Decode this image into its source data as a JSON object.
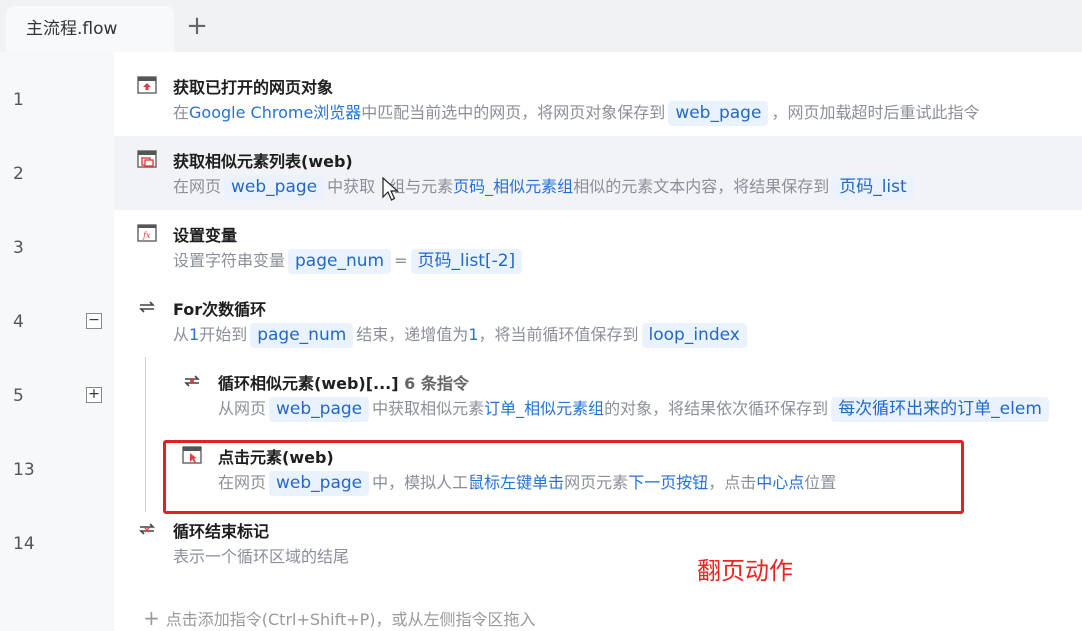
{
  "tab": {
    "label": "主流程.flow",
    "add_symbol": "+"
  },
  "line_numbers": [
    "1",
    "2",
    "3",
    "4",
    "5",
    "13",
    "14"
  ],
  "fold": {
    "collapse": "−",
    "expand": "+"
  },
  "steps": [
    {
      "title": "获取已打开的网页对象",
      "desc": {
        "prefix": "在",
        "browser": "Google Chrome浏览器",
        "mid": "中匹配当前选中的网页，将网页对象保存到",
        "var": "web_page",
        "suffix": "，网页加载超时后重试此指令"
      }
    },
    {
      "title": "获取相似元素列表(web)",
      "desc": {
        "prefix": "在网页",
        "var": "web_page",
        "mid1": "中获取",
        "mid1b": "组与元素",
        "element": "页码_相似元素组",
        "mid2": "相似的元素文本内容，将结果保存到",
        "result": "页码_list"
      }
    },
    {
      "title": "设置变量",
      "desc": {
        "prefix": "设置字符串变量",
        "var": "page_num",
        "eq": "=",
        "value": "页码_list[-2]"
      }
    },
    {
      "title": "For次数循环",
      "desc": {
        "p1": "从",
        "start": "1",
        "p2": "开始到",
        "var": "page_num",
        "p3": "结束，递增值为",
        "step": "1",
        "p4": "，将当前循环值保存到",
        "loopvar": "loop_index"
      }
    },
    {
      "title": "循环相似元素(web)[...]",
      "count": "6 条指令",
      "desc": {
        "prefix": "从网页",
        "var": "web_page",
        "mid": "中获取相似元素",
        "element": "订单_相似元素组",
        "suffix": "的对象，将结果依次循环保存到",
        "result": "每次循环出来的订单_elem"
      }
    },
    {
      "title": "点击元素(web)",
      "desc": {
        "prefix": "在网页",
        "var": "web_page",
        "mid": "中，模拟人工",
        "action": "鼠标左键单击",
        "mid2": "网页元素",
        "element": "下一页按钮",
        "mid3": "，点击",
        "point": "中心点",
        "suffix": "位置"
      }
    },
    {
      "title": "循环结束标记",
      "desc": {
        "text": "表示一个循环区域的结尾"
      }
    }
  ],
  "annotation": "翻页动作",
  "add_hint": {
    "plus": "+",
    "text": "点击添加指令(Ctrl+Shift+P)，或从左侧指令区拖入"
  },
  "colors": {
    "accent": "#2472d8",
    "chip_bg": "#eaf3fd",
    "highlight_box": "#e02222"
  }
}
